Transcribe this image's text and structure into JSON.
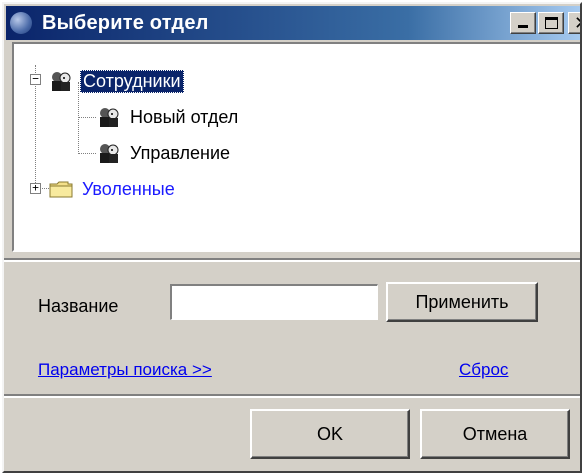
{
  "window": {
    "title": "Выберите отдел",
    "controls": {
      "minimize": "minimize",
      "maximize": "maximize",
      "close": "✕"
    }
  },
  "tree": {
    "root": {
      "label": "Сотрудники",
      "expanded": true,
      "selected": true,
      "icon": "people-icon"
    },
    "children": [
      {
        "label": "Новый отдел",
        "icon": "people-icon"
      },
      {
        "label": "Управление",
        "icon": "people-icon"
      }
    ],
    "second_root": {
      "label": "Уволенные",
      "expanded": false,
      "icon": "folder-icon"
    }
  },
  "search": {
    "name_label": "Название",
    "name_value": "",
    "apply_label": "Применить",
    "params_link": "Параметры поиска >>",
    "reset_link": "Сброс"
  },
  "footer": {
    "ok_label": "OK",
    "cancel_label": "Отмена"
  },
  "colors": {
    "titlebar_start": "#0a246a",
    "titlebar_end": "#a6caf0",
    "selection": "#0a246a",
    "link": "#0000ee",
    "face": "#d4d0c8"
  }
}
